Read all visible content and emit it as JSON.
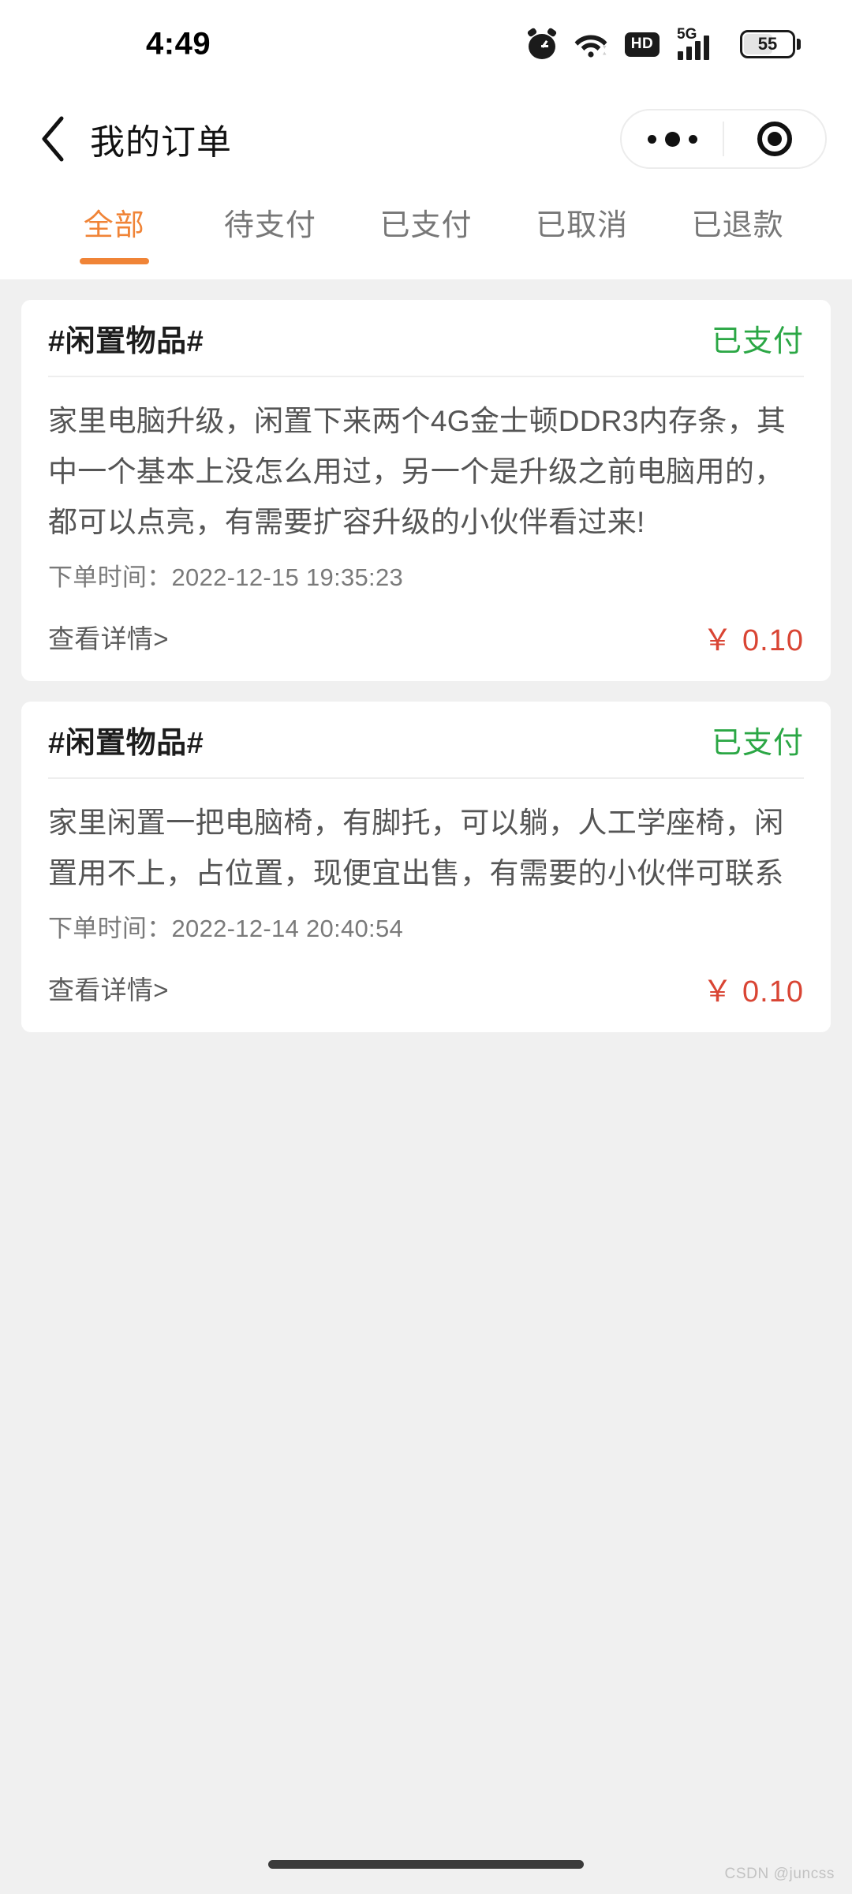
{
  "status_bar": {
    "time": "4:49",
    "battery_percent": "55",
    "network_label": "5G",
    "hd_label": "HD",
    "icons": [
      "alarm-icon",
      "wifi-icon",
      "hd-icon",
      "signal-5g-icon",
      "battery-icon"
    ]
  },
  "nav": {
    "back_label": "‹",
    "title": "我的订单"
  },
  "tabs": [
    {
      "label": "全部",
      "active": true
    },
    {
      "label": "待支付",
      "active": false
    },
    {
      "label": "已支付",
      "active": false
    },
    {
      "label": "已取消",
      "active": false
    },
    {
      "label": "已退款",
      "active": false
    }
  ],
  "orders": [
    {
      "title": "#闲置物品#",
      "status": "已支付",
      "description": "家里电脑升级，闲置下来两个4G金士顿DDR3内存条，其中一个基本上没怎么用过，另一个是升级之前电脑用的，都可以点亮，有需要扩容升级的小伙伴看过来!",
      "time": "下单时间：2022-12-15 19:35:23",
      "detail_link": "查看详情>",
      "price": "￥ 0.10"
    },
    {
      "title": "#闲置物品#",
      "status": "已支付",
      "description": "家里闲置一把电脑椅，有脚托，可以躺，人工学座椅，闲置用不上，占位置，现便宜出售，有需要的小伙伴可联系",
      "time": "下单时间：2022-12-14 20:40:54",
      "detail_link": "查看详情>",
      "price": "￥ 0.10"
    }
  ],
  "watermark": "CSDN @juncss",
  "colors": {
    "accent_orange": "#f08437",
    "status_green": "#2ba745",
    "price_red": "#d94534",
    "page_background": "#f0f0f0"
  }
}
